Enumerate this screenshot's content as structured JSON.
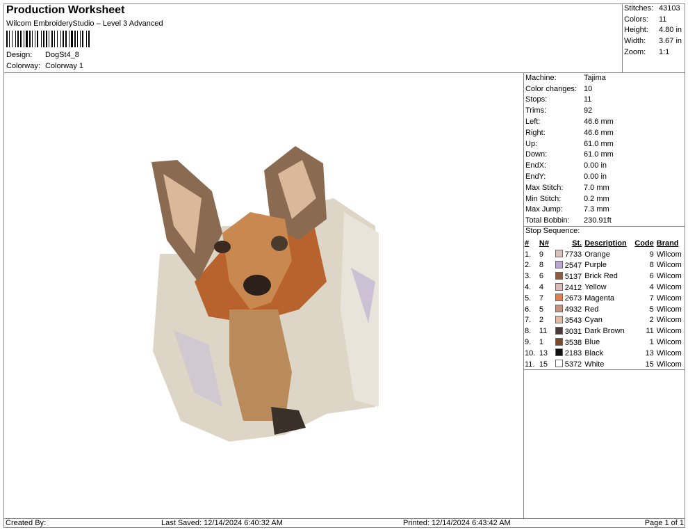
{
  "header": {
    "title": "Production Worksheet",
    "subtitle": "Wilcom EmbroideryStudio – Level 3 Advanced",
    "design_label": "Design:",
    "design": "DogSt4_8",
    "colorway_label": "Colorway:",
    "colorway": "Colorway 1"
  },
  "summary": [
    {
      "k": "Stitches:",
      "v": "43103"
    },
    {
      "k": "Colors:",
      "v": "11"
    },
    {
      "k": "Height:",
      "v": "4.80 in"
    },
    {
      "k": "Width:",
      "v": "3.67 in"
    },
    {
      "k": "Zoom:",
      "v": "1:1"
    }
  ],
  "details": [
    {
      "k": "Machine:",
      "v": "Tajima"
    },
    {
      "k": "Color changes:",
      "v": "10"
    },
    {
      "k": "Stops:",
      "v": "11"
    },
    {
      "k": "Trims:",
      "v": "92"
    },
    {
      "k": "Left:",
      "v": "46.6 mm"
    },
    {
      "k": "Right:",
      "v": "46.6 mm"
    },
    {
      "k": "Up:",
      "v": "61.0 mm"
    },
    {
      "k": "Down:",
      "v": "61.0 mm"
    },
    {
      "k": "EndX:",
      "v": "0.00 in"
    },
    {
      "k": "EndY:",
      "v": "0.00 in"
    },
    {
      "k": "Max Stitch:",
      "v": "7.0 mm"
    },
    {
      "k": "Min Stitch:",
      "v": "0.2 mm"
    },
    {
      "k": "Max Jump:",
      "v": "7.3 mm"
    },
    {
      "k": "Total Bobbin:",
      "v": "230.91ft"
    }
  ],
  "stop_sequence": {
    "title": "Stop Sequence:",
    "headers": [
      "#",
      "N#",
      "St.",
      "Description",
      "Code",
      "Brand"
    ],
    "rows": [
      {
        "n": "1.",
        "nn": "9",
        "color": "#d8c2bc",
        "st": "7733",
        "desc": "Orange",
        "code": "9",
        "brand": "Wilcom"
      },
      {
        "n": "2.",
        "nn": "8",
        "color": "#b9a9d2",
        "st": "2547",
        "desc": "Purple",
        "code": "8",
        "brand": "Wilcom"
      },
      {
        "n": "3.",
        "nn": "6",
        "color": "#8c5a3c",
        "st": "5137",
        "desc": "Brick Red",
        "code": "6",
        "brand": "Wilcom"
      },
      {
        "n": "4.",
        "nn": "4",
        "color": "#d9b9b9",
        "st": "2412",
        "desc": "Yellow",
        "code": "4",
        "brand": "Wilcom"
      },
      {
        "n": "5.",
        "nn": "7",
        "color": "#df7f4f",
        "st": "2673",
        "desc": "Magenta",
        "code": "7",
        "brand": "Wilcom"
      },
      {
        "n": "6.",
        "nn": "5",
        "color": "#c8927f",
        "st": "4932",
        "desc": "Red",
        "code": "5",
        "brand": "Wilcom"
      },
      {
        "n": "7.",
        "nn": "2",
        "color": "#e2b9a2",
        "st": "3543",
        "desc": "Cyan",
        "code": "2",
        "brand": "Wilcom"
      },
      {
        "n": "8.",
        "nn": "11",
        "color": "#4a3b3c",
        "st": "3031",
        "desc": "Dark Brown",
        "code": "11",
        "brand": "Wilcom"
      },
      {
        "n": "9.",
        "nn": "1",
        "color": "#7b4a2a",
        "st": "3538",
        "desc": "Blue",
        "code": "1",
        "brand": "Wilcom"
      },
      {
        "n": "10.",
        "nn": "13",
        "color": "#111111",
        "st": "2183",
        "desc": "Black",
        "code": "13",
        "brand": "Wilcom"
      },
      {
        "n": "11.",
        "nn": "15",
        "color": "#ffffff",
        "st": "5372",
        "desc": "White",
        "code": "15",
        "brand": "Wilcom"
      }
    ]
  },
  "footer": {
    "created": "Created By:",
    "saved": "Last Saved: 12/14/2024 6:40:32 AM",
    "printed": "Printed: 12/14/2024 6:43:42 AM",
    "page": "Page 1 of 1"
  }
}
